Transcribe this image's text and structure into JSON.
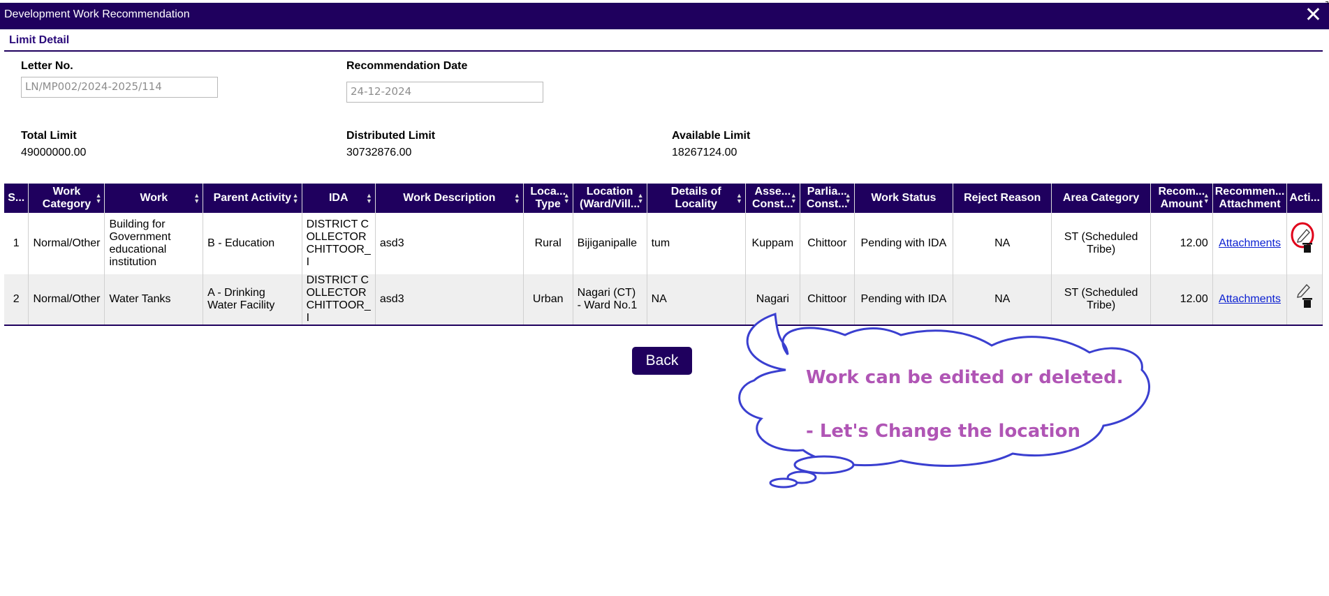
{
  "window": {
    "title": "Development Work Recommendation",
    "close_glyph": "✕"
  },
  "section": {
    "title": "Limit Detail"
  },
  "form": {
    "letter_no_label": "Letter No.",
    "letter_no_value": "LN/MP002/2024-2025/114",
    "rec_date_label": "Recommendation Date",
    "rec_date_value": "24-12-2024"
  },
  "limits": {
    "total_label": "Total Limit",
    "total_value": "49000000.00",
    "distributed_label": "Distributed Limit",
    "distributed_value": "30732876.00",
    "available_label": "Available Limit",
    "available_value": "18267124.00"
  },
  "table": {
    "headers": {
      "sno": "S...",
      "work_category": "Work Category",
      "work": "Work",
      "parent_activity": "Parent Activity",
      "ida": "IDA",
      "work_description": "Work Description",
      "location_type": "Loca... Type",
      "location": "Location (Ward/Vill...",
      "details_locality": "Details of Locality",
      "assembly": "Asse... Const...",
      "parliament": "Parlia... Const...",
      "work_status": "Work Status",
      "reject_reason": "Reject Reason",
      "area_category": "Area Category",
      "rec_amount": "Recom... Amount",
      "rec_attachment": "Recommen... Attachment",
      "action": "Acti..."
    },
    "rows": [
      {
        "sno": "1",
        "work_category": "Normal/Other",
        "work": "Building for Government educational institution",
        "parent_activity": "B - Education",
        "ida": "DISTRICT COLLECTOR CHITTOOR_I",
        "work_description": "asd3",
        "location_type": "Rural",
        "location": "Bijiganipalle",
        "details_locality": "tum",
        "assembly": "Kuppam",
        "parliament": "Chittoor",
        "work_status": "Pending with IDA",
        "reject_reason": "NA",
        "area_category": "ST (Scheduled Tribe)",
        "rec_amount": "12.00",
        "attachment": "Attachments",
        "edit_icon": "pencil-icon",
        "delete_icon": "trash-icon"
      },
      {
        "sno": "2",
        "work_category": "Normal/Other",
        "work": "Water Tanks",
        "parent_activity": "A - Drinking Water Facility",
        "ida": "DISTRICT COLLECTOR CHITTOOR_I",
        "work_description": "asd3",
        "location_type": "Urban",
        "location": "Nagari (CT) - Ward No.1",
        "details_locality": "NA",
        "assembly": "Nagari",
        "parliament": "Chittoor",
        "work_status": "Pending with IDA",
        "reject_reason": "NA",
        "area_category": "ST (Scheduled Tribe)",
        "rec_amount": "12.00",
        "attachment": "Attachments",
        "edit_icon": "pencil-icon",
        "delete_icon": "trash-icon"
      }
    ]
  },
  "buttons": {
    "back": "Back"
  },
  "annotation": {
    "line1": "Work can be edited or deleted.",
    "line2": "- Let's Change the location",
    "cloud_color": "#3a3fd0",
    "text_color": "#b055b5",
    "highlight_color": "#e0001a"
  },
  "colors": {
    "header_bg": "#1f005e",
    "link": "#0a1fd1"
  }
}
